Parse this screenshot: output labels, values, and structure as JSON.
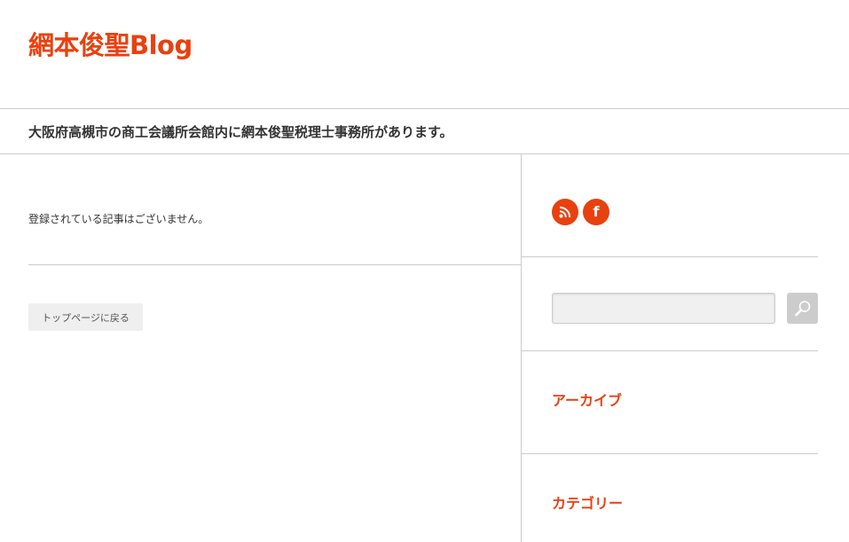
{
  "header": {
    "site_title": "網本俊聖Blog",
    "tagline": "大阪府高槻市の商工会議所会館内に網本俊聖税理士事務所があります。"
  },
  "main": {
    "empty_notice": "登録されている記事はございません。",
    "back_button_label": "トップページに戻る"
  },
  "sidebar": {
    "social": [
      {
        "icon": "rss-icon"
      },
      {
        "icon": "facebook-icon",
        "glyph": "f"
      }
    ],
    "search": {
      "placeholder": "",
      "button_icon": "search-icon"
    },
    "widgets": [
      {
        "title": "アーカイブ"
      },
      {
        "title": "カテゴリー"
      }
    ]
  },
  "colors": {
    "accent": "#e8410f",
    "text": "#333333",
    "divider": "#cccccc",
    "button_bg": "#efefef",
    "search_button_bg": "#cccccc"
  }
}
